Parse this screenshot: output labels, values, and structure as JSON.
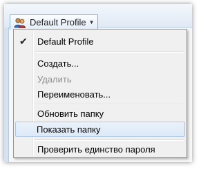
{
  "toolbar": {
    "profile_button_label": "Default Profile",
    "profile_icon": "users-icon",
    "dropdown_icon": "triangle-down-icon"
  },
  "menu": {
    "items": [
      {
        "label": "Default Profile",
        "checked": true,
        "enabled": true
      },
      {
        "label": "Создать...",
        "checked": false,
        "enabled": true
      },
      {
        "label": "Удалить",
        "checked": false,
        "enabled": false
      },
      {
        "label": "Переименовать...",
        "checked": false,
        "enabled": true
      },
      {
        "label": "Обновить папку",
        "checked": false,
        "enabled": true
      },
      {
        "label": "Показать папку",
        "checked": false,
        "enabled": true,
        "highlighted": true
      },
      {
        "label": "Проверить единство пароля",
        "checked": false,
        "enabled": true
      }
    ],
    "check_icon": "checkmark-icon"
  },
  "colors": {
    "menu_background": "#f0f0f0",
    "highlight_border": "#a9c6e8",
    "disabled_text": "#8d8d8d",
    "toolbar_background": "#dfe9f5"
  }
}
